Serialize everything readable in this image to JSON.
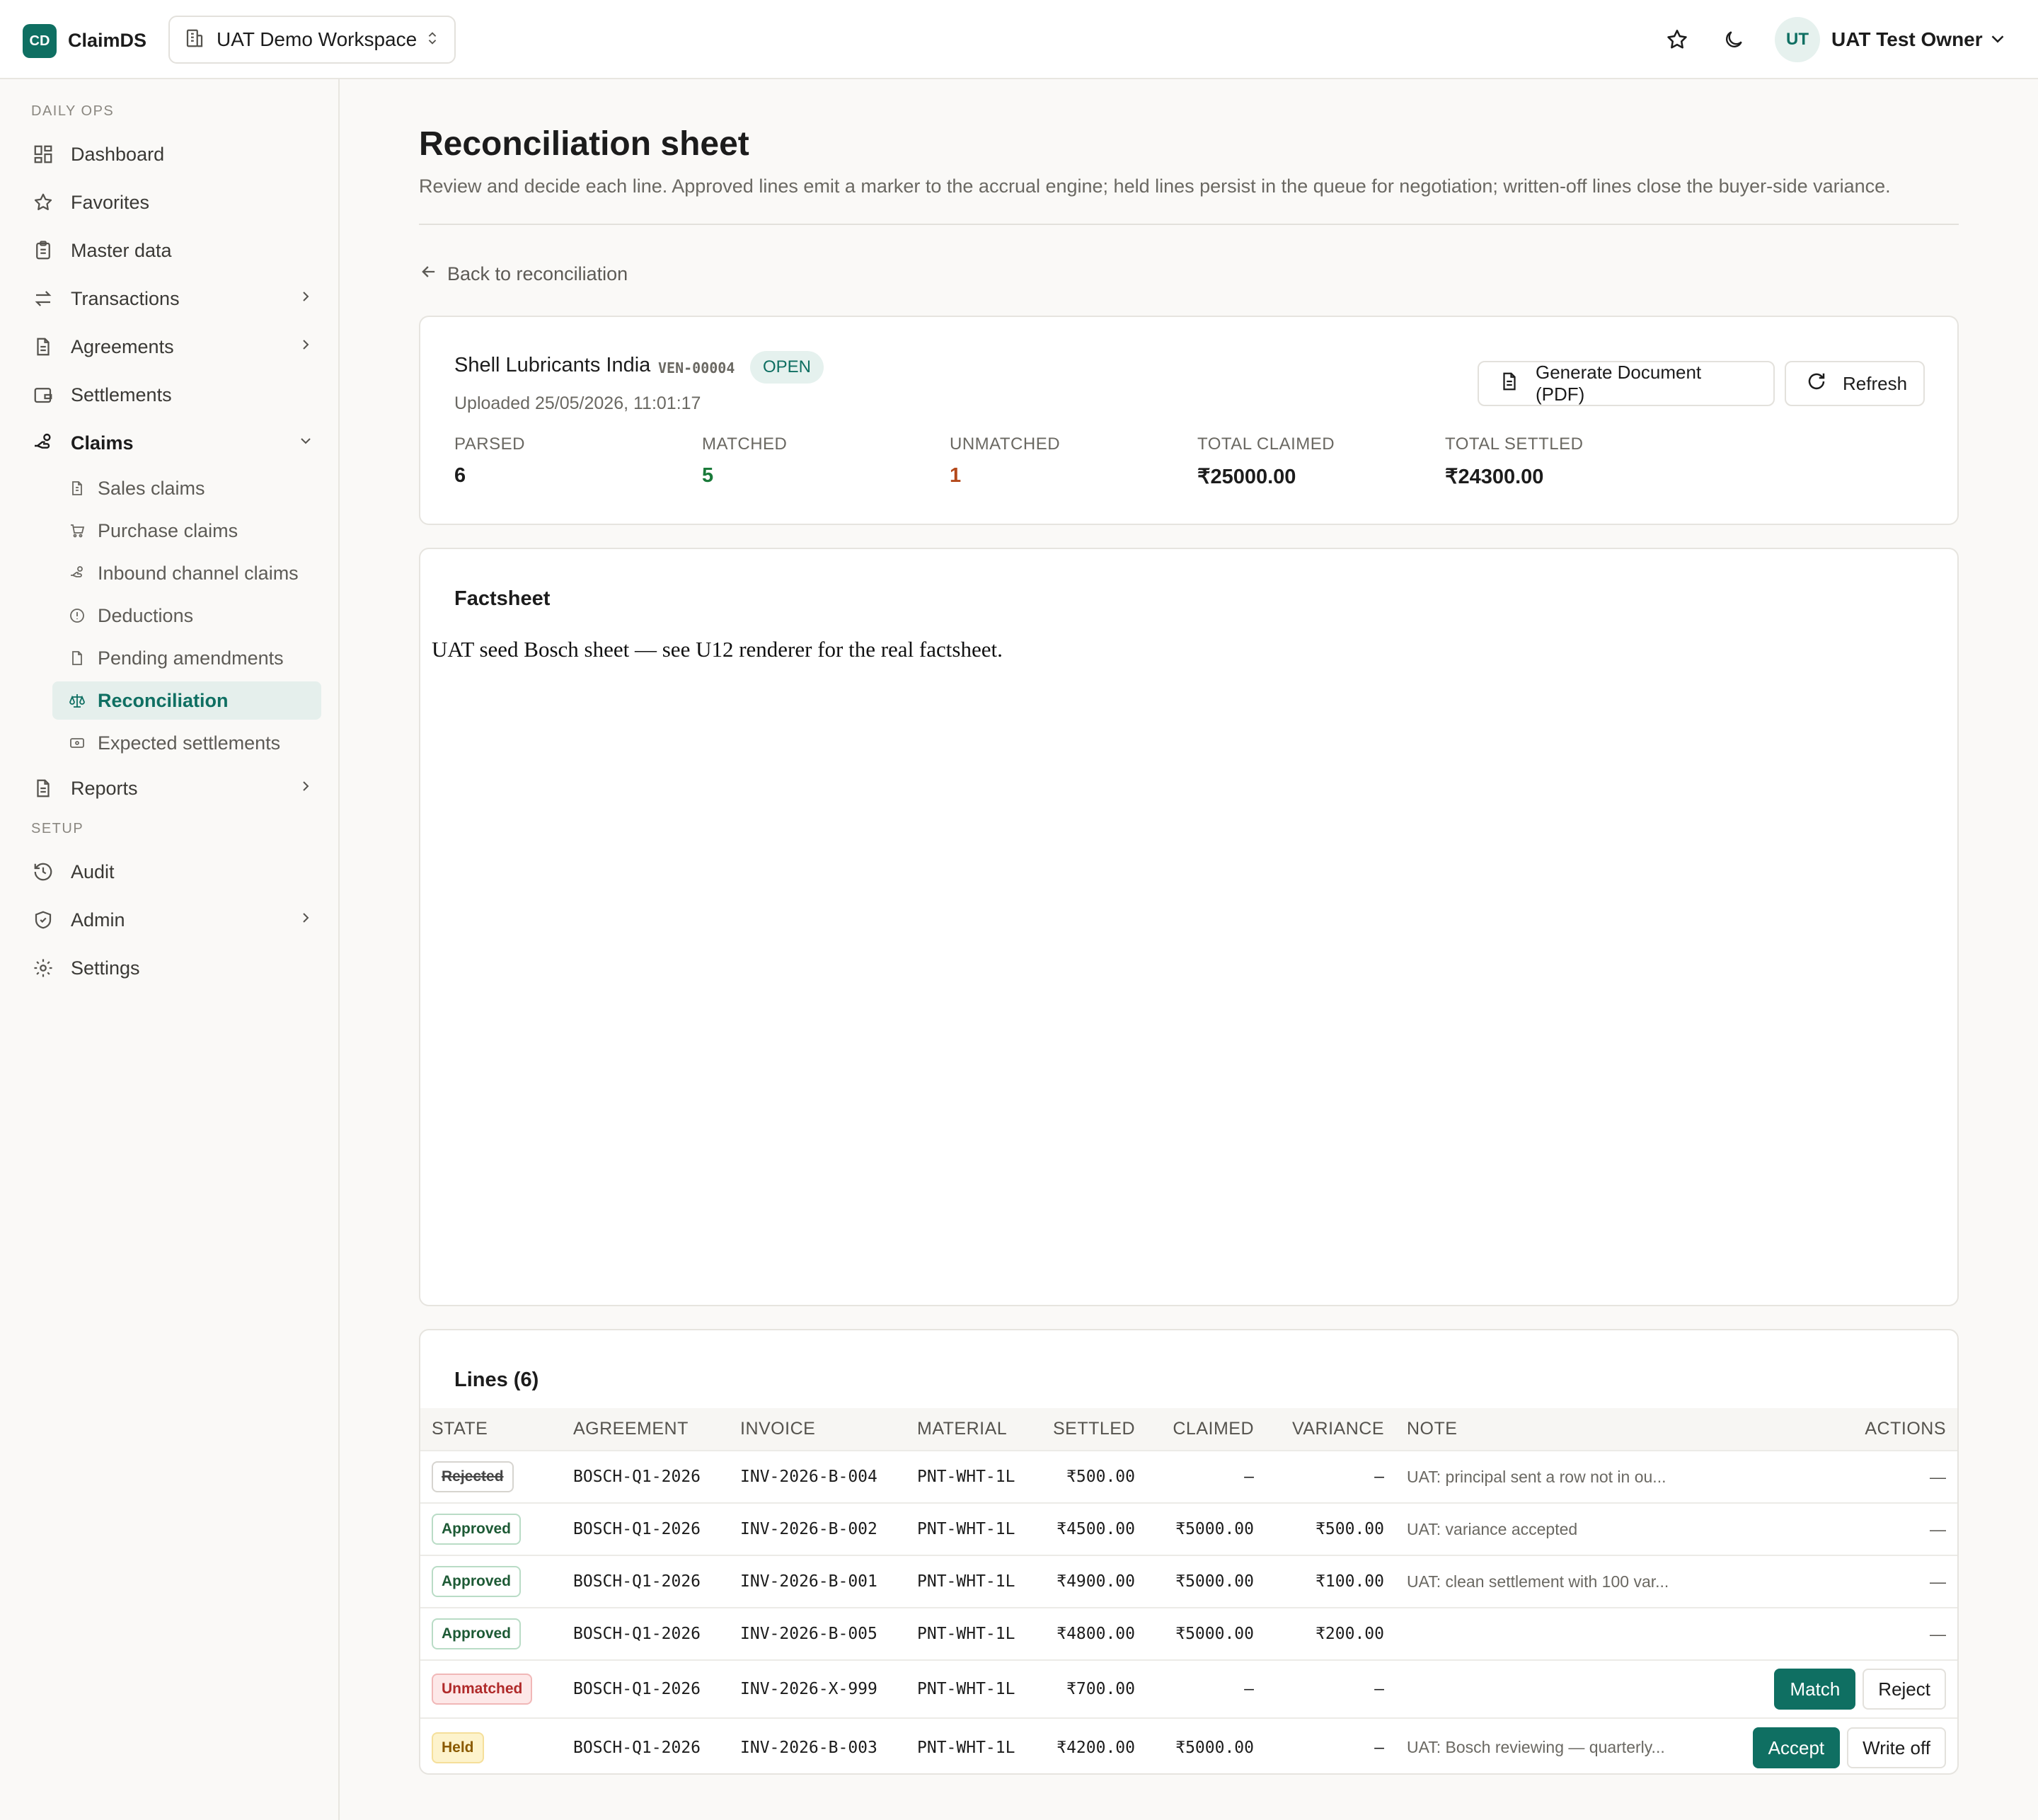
{
  "app": {
    "logo": "CD",
    "name": "ClaimDS"
  },
  "workspace": {
    "name": "UAT Demo Workspace"
  },
  "user": {
    "initials": "UT",
    "name": "UAT Test Owner"
  },
  "sidebar": {
    "section_daily": "DAILY OPS",
    "section_setup": "SETUP",
    "items": {
      "dashboard": "Dashboard",
      "favorites": "Favorites",
      "master_data": "Master data",
      "transactions": "Transactions",
      "agreements": "Agreements",
      "settlements": "Settlements",
      "claims": "Claims",
      "reports": "Reports",
      "audit": "Audit",
      "admin": "Admin",
      "settings": "Settings"
    },
    "claims_sub": {
      "sales": "Sales claims",
      "purchase": "Purchase claims",
      "inbound": "Inbound channel claims",
      "deductions": "Deductions",
      "pending": "Pending amendments",
      "reconciliation": "Reconciliation",
      "expected": "Expected settlements"
    }
  },
  "page": {
    "title": "Reconciliation sheet",
    "description": "Review and decide each line. Approved lines emit a marker to the accrual engine; held lines persist in the queue for negotiation; written-off lines close the buyer-side variance.",
    "back_link": "Back to reconciliation"
  },
  "summary": {
    "vendor": "Shell Lubricants India",
    "vendor_code": "VEN-00004",
    "status": "OPEN",
    "uploaded": "Uploaded 25/05/2026, 11:01:17",
    "generate_label": "Generate Document (PDF)",
    "refresh_label": "Refresh",
    "stats": {
      "parsed_label": "PARSED",
      "parsed": "6",
      "matched_label": "MATCHED",
      "matched": "5",
      "unmatched_label": "UNMATCHED",
      "unmatched": "1",
      "claimed_label": "TOTAL CLAIMED",
      "claimed": "₹25000.00",
      "settled_label": "TOTAL SETTLED",
      "settled": "₹24300.00"
    }
  },
  "factsheet": {
    "title": "Factsheet",
    "text": "UAT seed Bosch sheet — see U12 renderer for the real factsheet."
  },
  "lines": {
    "title": "Lines (6)",
    "headers": {
      "state": "STATE",
      "agreement": "AGREEMENT",
      "invoice": "INVOICE",
      "material": "MATERIAL",
      "settled": "SETTLED",
      "claimed": "CLAIMED",
      "variance": "VARIANCE",
      "note": "NOTE",
      "actions": "ACTIONS"
    },
    "rows": [
      {
        "state": "Rejected",
        "agreement": "BOSCH-Q1-2026",
        "invoice": "INV-2026-B-004",
        "material": "PNT-WHT-1L",
        "settled": "₹500.00",
        "claimed": "–",
        "variance": "–",
        "note": "UAT: principal sent a row not in ou...",
        "action": "—"
      },
      {
        "state": "Approved",
        "agreement": "BOSCH-Q1-2026",
        "invoice": "INV-2026-B-002",
        "material": "PNT-WHT-1L",
        "settled": "₹4500.00",
        "claimed": "₹5000.00",
        "variance": "₹500.00",
        "note": "UAT: variance accepted",
        "action": "—"
      },
      {
        "state": "Approved",
        "agreement": "BOSCH-Q1-2026",
        "invoice": "INV-2026-B-001",
        "material": "PNT-WHT-1L",
        "settled": "₹4900.00",
        "claimed": "₹5000.00",
        "variance": "₹100.00",
        "note": "UAT: clean settlement with 100 var...",
        "action": "—"
      },
      {
        "state": "Approved",
        "agreement": "BOSCH-Q1-2026",
        "invoice": "INV-2026-B-005",
        "material": "PNT-WHT-1L",
        "settled": "₹4800.00",
        "claimed": "₹5000.00",
        "variance": "₹200.00",
        "note": "",
        "action": "—"
      },
      {
        "state": "Unmatched",
        "agreement": "BOSCH-Q1-2026",
        "invoice": "INV-2026-X-999",
        "material": "PNT-WHT-1L",
        "settled": "₹700.00",
        "claimed": "–",
        "variance": "–",
        "note": "",
        "btn1": "Match",
        "btn2": "Reject"
      },
      {
        "state": "Held",
        "agreement": "BOSCH-Q1-2026",
        "invoice": "INV-2026-B-003",
        "material": "PNT-WHT-1L",
        "settled": "₹4200.00",
        "claimed": "₹5000.00",
        "variance": "–",
        "note": "UAT: Bosch reviewing — quarterly...",
        "btn1": "Accept",
        "btn2": "Write off"
      }
    ]
  },
  "colors": {
    "brand": "#0f6f62",
    "matched": "#1a7a3a",
    "unmatched": "#b4491b"
  },
  "icons": [
    "star-icon",
    "moon-icon",
    "building-icon",
    "chevrons-updown-icon"
  ]
}
